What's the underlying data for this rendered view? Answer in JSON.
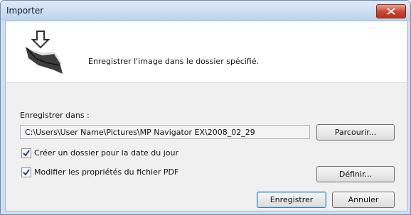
{
  "window": {
    "title": "Importer"
  },
  "header": {
    "description": "Enregistrer l'image dans le dossier spécifié."
  },
  "save_location": {
    "label": "Enregistrer dans :",
    "path": "C:\\Users\\User Name\\Pictures\\MP Navigator EX\\2008_02_29",
    "browse_label": "Parcourir..."
  },
  "options": [
    {
      "label": "Créer un dossier pour la date du jour",
      "checked": true
    },
    {
      "label": "Modifier les propriétés du fichier PDF",
      "checked": true
    }
  ],
  "define_label": "Définir...",
  "buttons": {
    "save_label": "Enregistrer",
    "cancel_label": "Annuler"
  },
  "colors": {
    "close_button": "#c8452e",
    "default_button_border": "#3c7fb1"
  },
  "icons": {
    "header": "import-folder-icon",
    "close": "close-icon"
  }
}
